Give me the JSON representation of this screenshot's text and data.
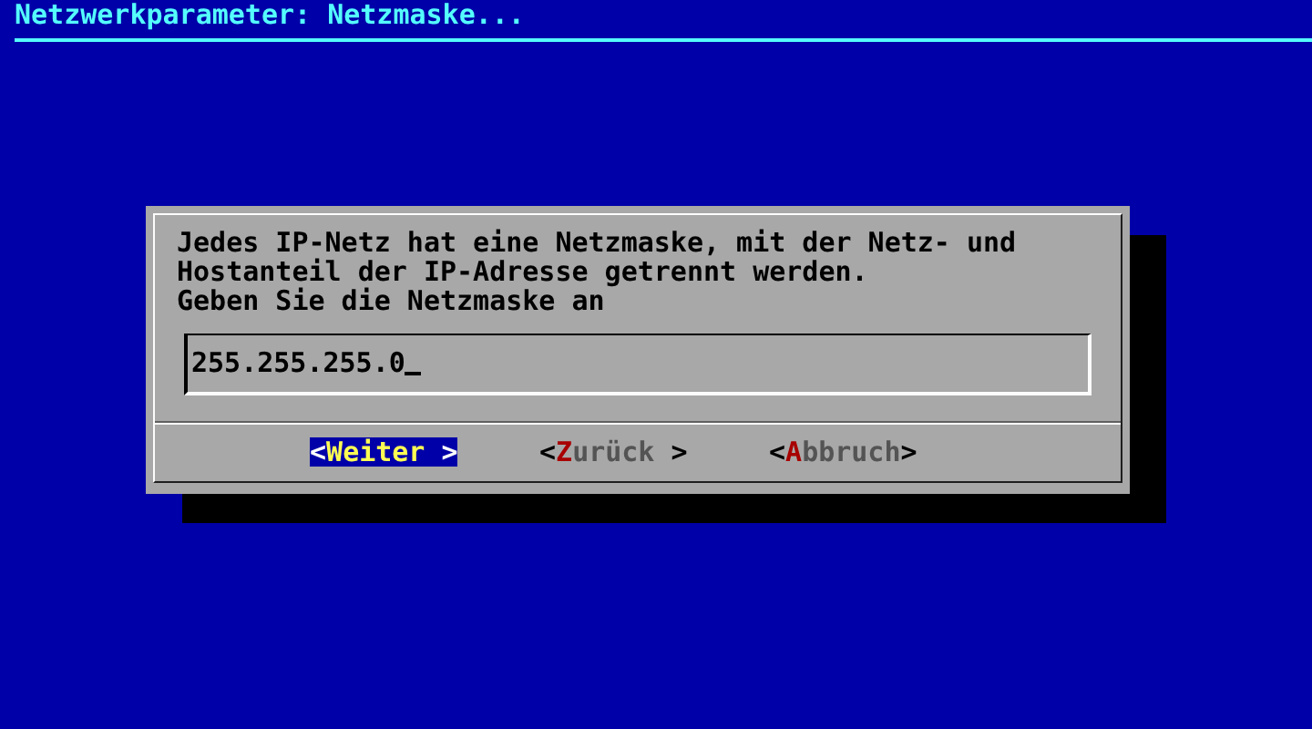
{
  "screen": {
    "title": "Netzwerkparameter: Netzmaske..."
  },
  "dialog": {
    "message": [
      "Jedes IP-Netz hat eine Netzmaske, mit der Netz- und",
      "Hostanteil der IP-Adresse getrennt werden.",
      "Geben Sie die Netzmaske an"
    ],
    "input": {
      "value": "255.255.255.0",
      "focused": true
    },
    "buttons": [
      {
        "selected": true,
        "parts": [
          {
            "kind": "bracket",
            "text": "<"
          },
          {
            "kind": "hotkey",
            "text": "W"
          },
          {
            "kind": "label",
            "text": "eiter"
          },
          {
            "kind": "bracket",
            "text": " >"
          }
        ]
      },
      {
        "selected": false,
        "parts": [
          {
            "kind": "bracket",
            "text": "<"
          },
          {
            "kind": "hotkey",
            "text": "Z"
          },
          {
            "kind": "label",
            "text": "urück"
          },
          {
            "kind": "bracket",
            "text": " >"
          }
        ]
      },
      {
        "selected": false,
        "parts": [
          {
            "kind": "bracket",
            "text": "<"
          },
          {
            "kind": "hotkey",
            "text": "A"
          },
          {
            "kind": "label",
            "text": "bbruch"
          },
          {
            "kind": "bracket",
            "text": ">"
          }
        ]
      }
    ]
  }
}
